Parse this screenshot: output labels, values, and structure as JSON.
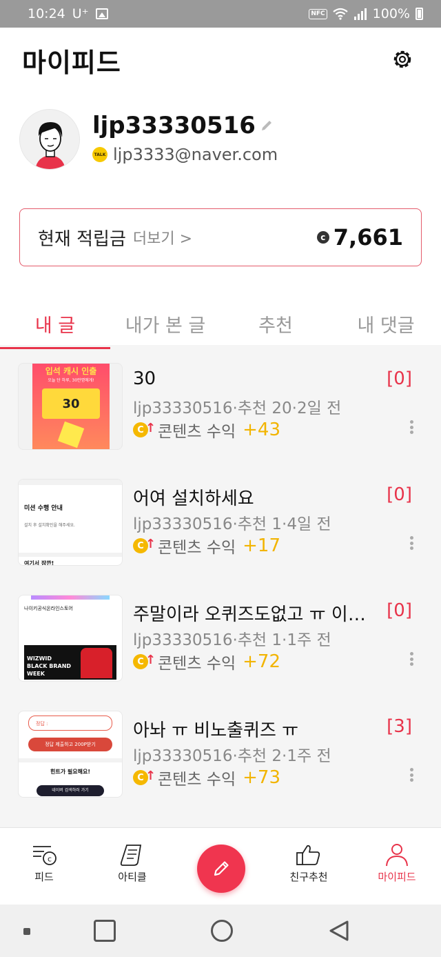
{
  "status_bar": {
    "time": "10:24",
    "carrier": "U⁺",
    "nfc": "NFC",
    "battery": "100%"
  },
  "header": {
    "title": "마이피드"
  },
  "profile": {
    "username": "ljp33330516",
    "email": "ljp3333@naver.com",
    "talk_badge": "TALK"
  },
  "points": {
    "label": "현재 적립금",
    "more": "더보기 >",
    "coin_symbol": "c",
    "value": "7,661"
  },
  "tabs": [
    {
      "label": "내 글",
      "active": true
    },
    {
      "label": "내가 본 글",
      "active": false
    },
    {
      "label": "추천",
      "active": false
    },
    {
      "label": "내 댓글",
      "active": false
    }
  ],
  "posts": [
    {
      "title": "30",
      "comments": "[0]",
      "author": "ljp33330516",
      "recommend": "추천 20",
      "time": "2일 전",
      "earn_label": "콘텐츠 수익",
      "earn_value": "+43"
    },
    {
      "title": "어여 설치하세요",
      "comments": "[0]",
      "author": "ljp33330516",
      "recommend": "추천 1",
      "time": "4일 전",
      "earn_label": "콘텐츠 수익",
      "earn_value": "+17"
    },
    {
      "title": "주말이라 오퀴즈도없고 ㅠ 이…",
      "comments": "[0]",
      "author": "ljp33330516",
      "recommend": "추천 1",
      "time": "1주 전",
      "earn_label": "콘텐츠 수익",
      "earn_value": "+72"
    },
    {
      "title": "아놔 ㅠ 비노출퀴즈 ㅠ",
      "comments": "[3]",
      "author": "ljp33330516",
      "recommend": "추천 2",
      "time": "1주 전",
      "earn_label": "콘텐츠 수익",
      "earn_value": "+73"
    }
  ],
  "thumbs": {
    "t1_banner": "입석 캐시 인출",
    "t1_sub": "오늘 단 하루, 30만명에게!",
    "t1_coupon": "30",
    "t2_head": "미션 수행 안내",
    "t2_body": "설치 후 설치확인을 해주세요.",
    "t2_footer": "여기서 잠깐!",
    "t3_title": "나이키공식온라인스토어",
    "t3_banner": "WIZWID BLACK BRAND WEEK",
    "t4_input": "정답 :",
    "t4_button": "정답 제출하고 200P받기",
    "t4_hint": "힌트가 필요해요!",
    "t4_search": "네이버 검색하러 가기"
  },
  "bottom_nav": [
    {
      "label": "피드",
      "icon": "feed-icon"
    },
    {
      "label": "아티클",
      "icon": "article-icon"
    },
    {
      "label": "친구추천",
      "icon": "thumbs-up-icon"
    },
    {
      "label": "마이피드",
      "icon": "person-icon",
      "active": true
    }
  ],
  "colors": {
    "accent": "#e8334a",
    "coin": "#f2b400"
  }
}
